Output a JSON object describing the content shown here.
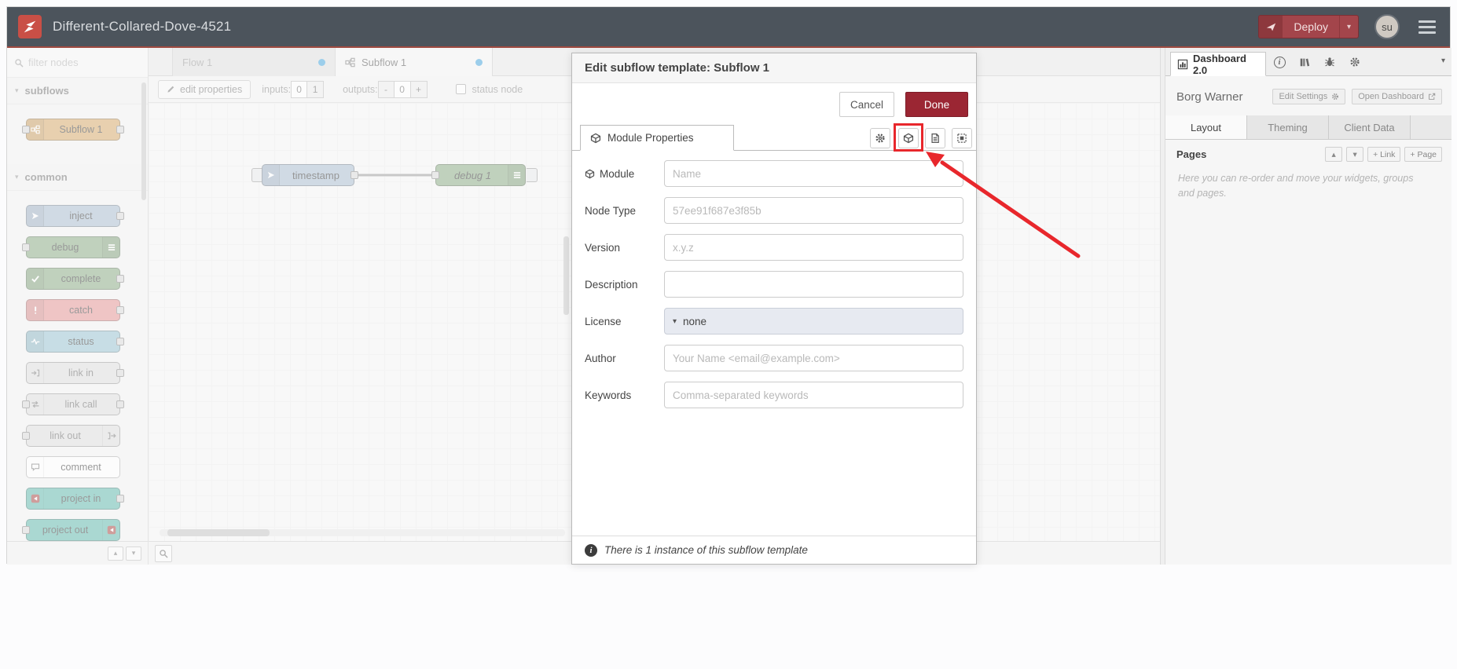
{
  "icons": {
    "caret_down": "▾",
    "up_arrow": "▴",
    "down_arrow": "▾",
    "info": "i"
  },
  "colors": {
    "header_bg": "#4c545c",
    "brand_red": "#c94f46",
    "deploy_bg": "#a3454b",
    "done_button_bg": "#9b2633",
    "annotation_red": "#e8272c",
    "tab_modified_dot": "#3fa3dc",
    "node_subflow": "#d6a764",
    "node_inject": "#a6bbcf",
    "node_debug": "#87a980",
    "node_complete": "#87a980",
    "node_catch": "#e49191",
    "node_status": "#94c1d0",
    "node_link": "#dcdcdc",
    "node_comment": "#ffffff",
    "node_project": "#5bb7ab"
  },
  "header": {
    "title": "Different-Collared-Dove-4521",
    "deploy": {
      "label": "Deploy"
    },
    "user": {
      "initials": "su"
    }
  },
  "palette": {
    "filter_placeholder": "filter nodes",
    "categories": [
      {
        "label": "subflows",
        "nodes": [
          {
            "label": "Subflow 1",
            "color": "#d6a764"
          }
        ]
      },
      {
        "label": "common",
        "nodes": [
          {
            "label": "inject",
            "color": "#a6bbcf"
          },
          {
            "label": "debug",
            "color": "#87a980"
          },
          {
            "label": "complete",
            "color": "#87a980"
          },
          {
            "label": "catch",
            "color": "#e49191"
          },
          {
            "label": "status",
            "color": "#94c1d0"
          },
          {
            "label": "link in",
            "color": "#dcdcdc"
          },
          {
            "label": "link call",
            "color": "#dcdcdc"
          },
          {
            "label": "link out",
            "color": "#dcdcdc"
          },
          {
            "label": "comment",
            "color": "#ffffff"
          },
          {
            "label": "project in",
            "color": "#5bb7ab"
          },
          {
            "label": "project out",
            "color": "#5bb7ab"
          }
        ]
      }
    ]
  },
  "workspace": {
    "tabs": [
      {
        "label": "Flow 1",
        "modified": true,
        "active": false
      },
      {
        "label": "Subflow 1",
        "modified": true,
        "active": true
      }
    ],
    "toolbar": {
      "edit_properties": "edit properties",
      "inputs_label": "inputs:",
      "inputs_options": [
        "0",
        "1"
      ],
      "outputs_label": "outputs:",
      "outputs_decrease": "-",
      "outputs_value": "0",
      "outputs_increase": "+",
      "status_node_label": "status node"
    },
    "canvas": {
      "nodes": [
        {
          "label": "timestamp",
          "type": "inject",
          "color": "#a6bbcf"
        },
        {
          "label": "debug 1",
          "type": "debug",
          "color": "#87a980"
        }
      ]
    }
  },
  "dialog": {
    "title": "Edit subflow template: Subflow 1",
    "cancel": "Cancel",
    "done": "Done",
    "tab": "Module Properties",
    "fields": {
      "module": {
        "label": "Module",
        "placeholder": "Name"
      },
      "node_type": {
        "label": "Node Type",
        "placeholder": "57ee91f687e3f85b"
      },
      "version": {
        "label": "Version",
        "placeholder": "x.y.z"
      },
      "description": {
        "label": "Description",
        "placeholder": ""
      },
      "license": {
        "label": "License",
        "value": "none"
      },
      "author": {
        "label": "Author",
        "placeholder": "Your Name <email@example.com>"
      },
      "keywords": {
        "label": "Keywords",
        "placeholder": "Comma-separated keywords"
      }
    },
    "footer_note": "There is 1 instance of this subflow template"
  },
  "sidebar": {
    "tab": "Dashboard 2.0",
    "dashboard_name": "Borg Warner",
    "edit_settings": "Edit Settings",
    "open_dashboard": "Open Dashboard",
    "tabs": [
      "Layout",
      "Theming",
      "Client Data"
    ],
    "pages_label": "Pages",
    "add_link": "+ Link",
    "add_page": "+ Page",
    "help_text": "Here you can re-order and move your widgets, groups and pages."
  },
  "annotation": {
    "highlighted_control": "module-properties-icon-button"
  }
}
